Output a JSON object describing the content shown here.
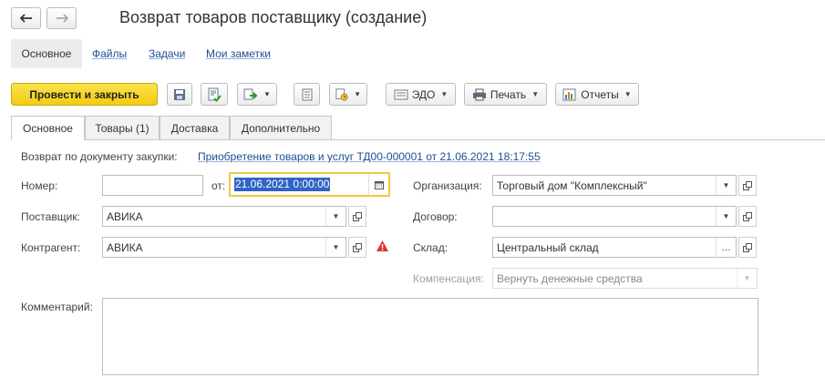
{
  "window": {
    "title": "Возврат товаров поставщику (создание)"
  },
  "sections": {
    "main": "Основное",
    "files": "Файлы",
    "tasks": "Задачи",
    "notes": "Мои заметки"
  },
  "toolbar": {
    "post_close": "Провести и закрыть",
    "edo": "ЭДО",
    "print": "Печать",
    "reports": "Отчеты"
  },
  "tabs": {
    "main": "Основное",
    "goods": "Товары (1)",
    "delivery": "Доставка",
    "additional": "Дополнительно"
  },
  "form": {
    "basis_label": "Возврат по документу закупки:",
    "basis_link": "Приобретение товаров и услуг ТД00-000001 от 21.06.2021 18:17:55",
    "number_label": "Номер:",
    "number_value": "",
    "date_label": "от:",
    "date_value": "21.06.2021  0:00:00",
    "supplier_label": "Поставщик:",
    "supplier_value": "АВИКА",
    "counterparty_label": "Контрагент:",
    "counterparty_value": "АВИКА",
    "org_label": "Организация:",
    "org_value": "Торговый дом \"Комплексный\"",
    "contract_label": "Договор:",
    "contract_value": "",
    "warehouse_label": "Склад:",
    "warehouse_value": "Центральный склад",
    "compensation_label": "Компенсация:",
    "compensation_value": "Вернуть денежные средства",
    "comment_label": "Комментарий:",
    "comment_value": ""
  },
  "colors": {
    "primary_button": "#f5d21f",
    "link": "#1c4e94",
    "date_focus": "#f2c744",
    "selection": "#2f64c4",
    "warning": "#d9342b"
  }
}
